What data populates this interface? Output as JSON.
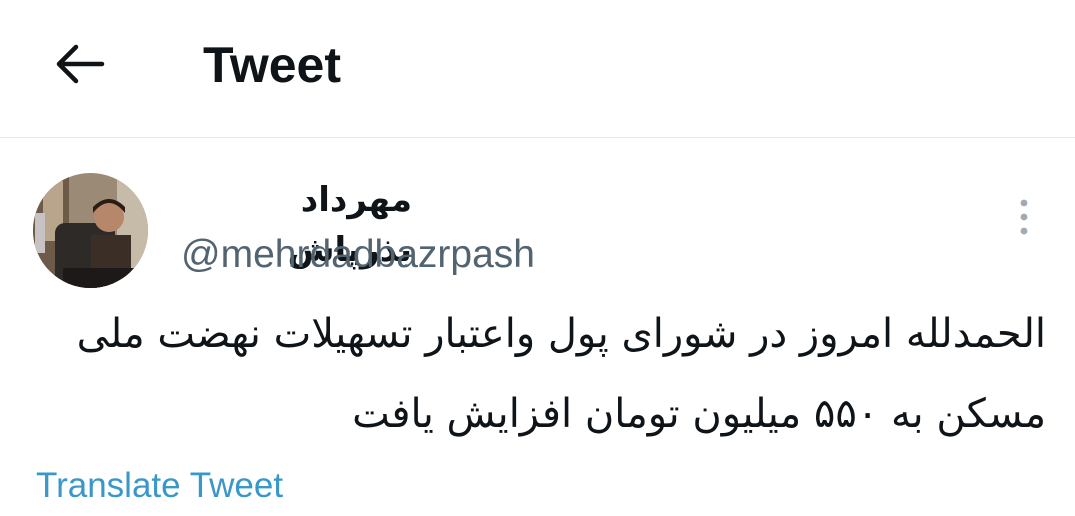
{
  "header": {
    "back_icon": "arrow-left-icon",
    "title": "Tweet"
  },
  "tweet": {
    "author": {
      "display_name": "مهرداد بذرپاش",
      "handle": "@mehrdadbazrpash"
    },
    "more_icon": "more-vertical-icon",
    "text": "الحمدلله امروز در شورای پول واعتبار تسهیلات نهضت ملی مسکن به ۵۵۰ میلیون تومان افزایش یافت",
    "translate_label": "Translate Tweet"
  },
  "colors": {
    "text_primary": "#0f1419",
    "text_secondary": "#536471",
    "link": "#3a97c9",
    "divider": "#e6e9ea"
  }
}
